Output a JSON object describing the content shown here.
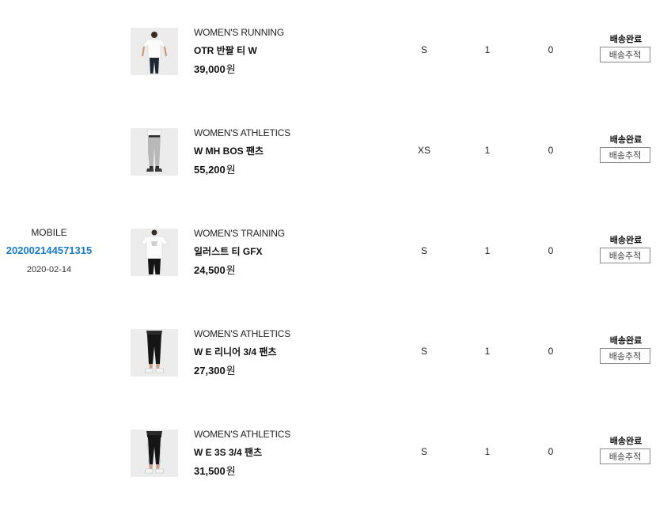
{
  "order": {
    "channel": "MOBILE",
    "number": "202002144571315",
    "date": "2020-02-14"
  },
  "items": [
    {
      "category": "WOMEN'S RUNNING",
      "name": "OTR 반팔 티 W",
      "price": "39,000",
      "currency": "원",
      "size": "S",
      "quantity": "1",
      "points": "0",
      "status": "배송완료",
      "track_label": "배송추적"
    },
    {
      "category": "WOMEN'S ATHLETICS",
      "name": "W MH BOS 팬츠",
      "price": "55,200",
      "currency": "원",
      "size": "XS",
      "quantity": "1",
      "points": "0",
      "status": "배송완료",
      "track_label": "배송추적"
    },
    {
      "category": "WOMEN'S TRAINING",
      "name": "일러스트 티 GFX",
      "price": "24,500",
      "currency": "원",
      "size": "S",
      "quantity": "1",
      "points": "0",
      "status": "배송완료",
      "track_label": "배송추적"
    },
    {
      "category": "WOMEN'S ATHLETICS",
      "name": "W E 리니어 3/4 팬츠",
      "price": "27,300",
      "currency": "원",
      "size": "S",
      "quantity": "1",
      "points": "0",
      "status": "배송완료",
      "track_label": "배송추적"
    },
    {
      "category": "WOMEN'S ATHLETICS",
      "name": "W E 3S 3/4 팬츠",
      "price": "31,500",
      "currency": "원",
      "size": "S",
      "quantity": "1",
      "points": "0",
      "status": "배송완료",
      "track_label": "배송추적"
    }
  ]
}
